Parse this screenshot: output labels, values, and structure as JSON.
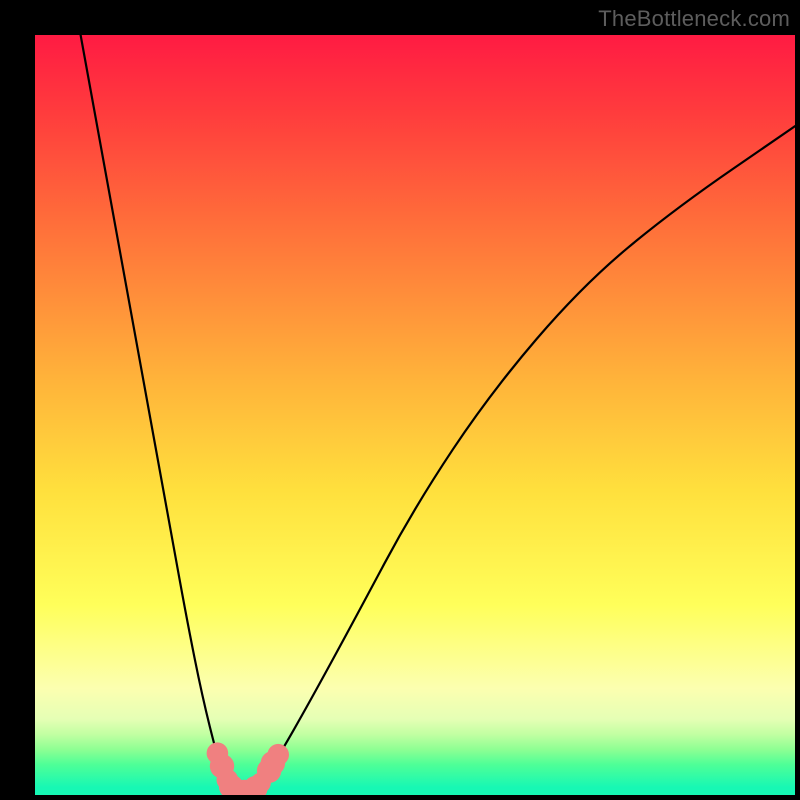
{
  "watermark": "TheBottleneck.com",
  "chart_data": {
    "type": "line",
    "title": "",
    "xlabel": "",
    "ylabel": "",
    "xlim": [
      0,
      100
    ],
    "ylim": [
      0,
      100
    ],
    "series": [
      {
        "name": "bottleneck-curve",
        "x": [
          6,
          10,
          14,
          18,
          20,
          22,
          24,
          25,
          26,
          27,
          28,
          29,
          30,
          32,
          36,
          42,
          50,
          60,
          72,
          84,
          100
        ],
        "values": [
          100,
          78,
          56,
          34,
          23,
          13,
          5,
          2,
          0.6,
          0.5,
          0.6,
          1.2,
          2,
          5,
          12,
          23,
          38,
          53,
          67,
          77,
          88
        ]
      }
    ],
    "markers": {
      "name": "curve-points",
      "color": "#f08080",
      "points": [
        {
          "x": 24.0,
          "y": 5.5,
          "r": 1.0
        },
        {
          "x": 24.6,
          "y": 3.8,
          "r": 1.2
        },
        {
          "x": 25.3,
          "y": 2.0,
          "r": 1.0
        },
        {
          "x": 25.8,
          "y": 1.1,
          "r": 1.2
        },
        {
          "x": 26.5,
          "y": 0.6,
          "r": 0.9
        },
        {
          "x": 27.5,
          "y": 0.5,
          "r": 1.1
        },
        {
          "x": 28.3,
          "y": 0.6,
          "r": 1.0
        },
        {
          "x": 29.0,
          "y": 0.9,
          "r": 1.2
        },
        {
          "x": 29.7,
          "y": 1.6,
          "r": 0.9
        },
        {
          "x": 30.8,
          "y": 3.2,
          "r": 1.2
        },
        {
          "x": 31.3,
          "y": 4.2,
          "r": 1.2
        },
        {
          "x": 32.0,
          "y": 5.3,
          "r": 1.0
        }
      ]
    },
    "gradient_stops": [
      {
        "pos": 0,
        "color": "#ff1b43"
      },
      {
        "pos": 25,
        "color": "#ff6f3a"
      },
      {
        "pos": 60,
        "color": "#ffe03d"
      },
      {
        "pos": 86,
        "color": "#fcffb0"
      },
      {
        "pos": 100,
        "color": "#16f8b4"
      }
    ]
  }
}
